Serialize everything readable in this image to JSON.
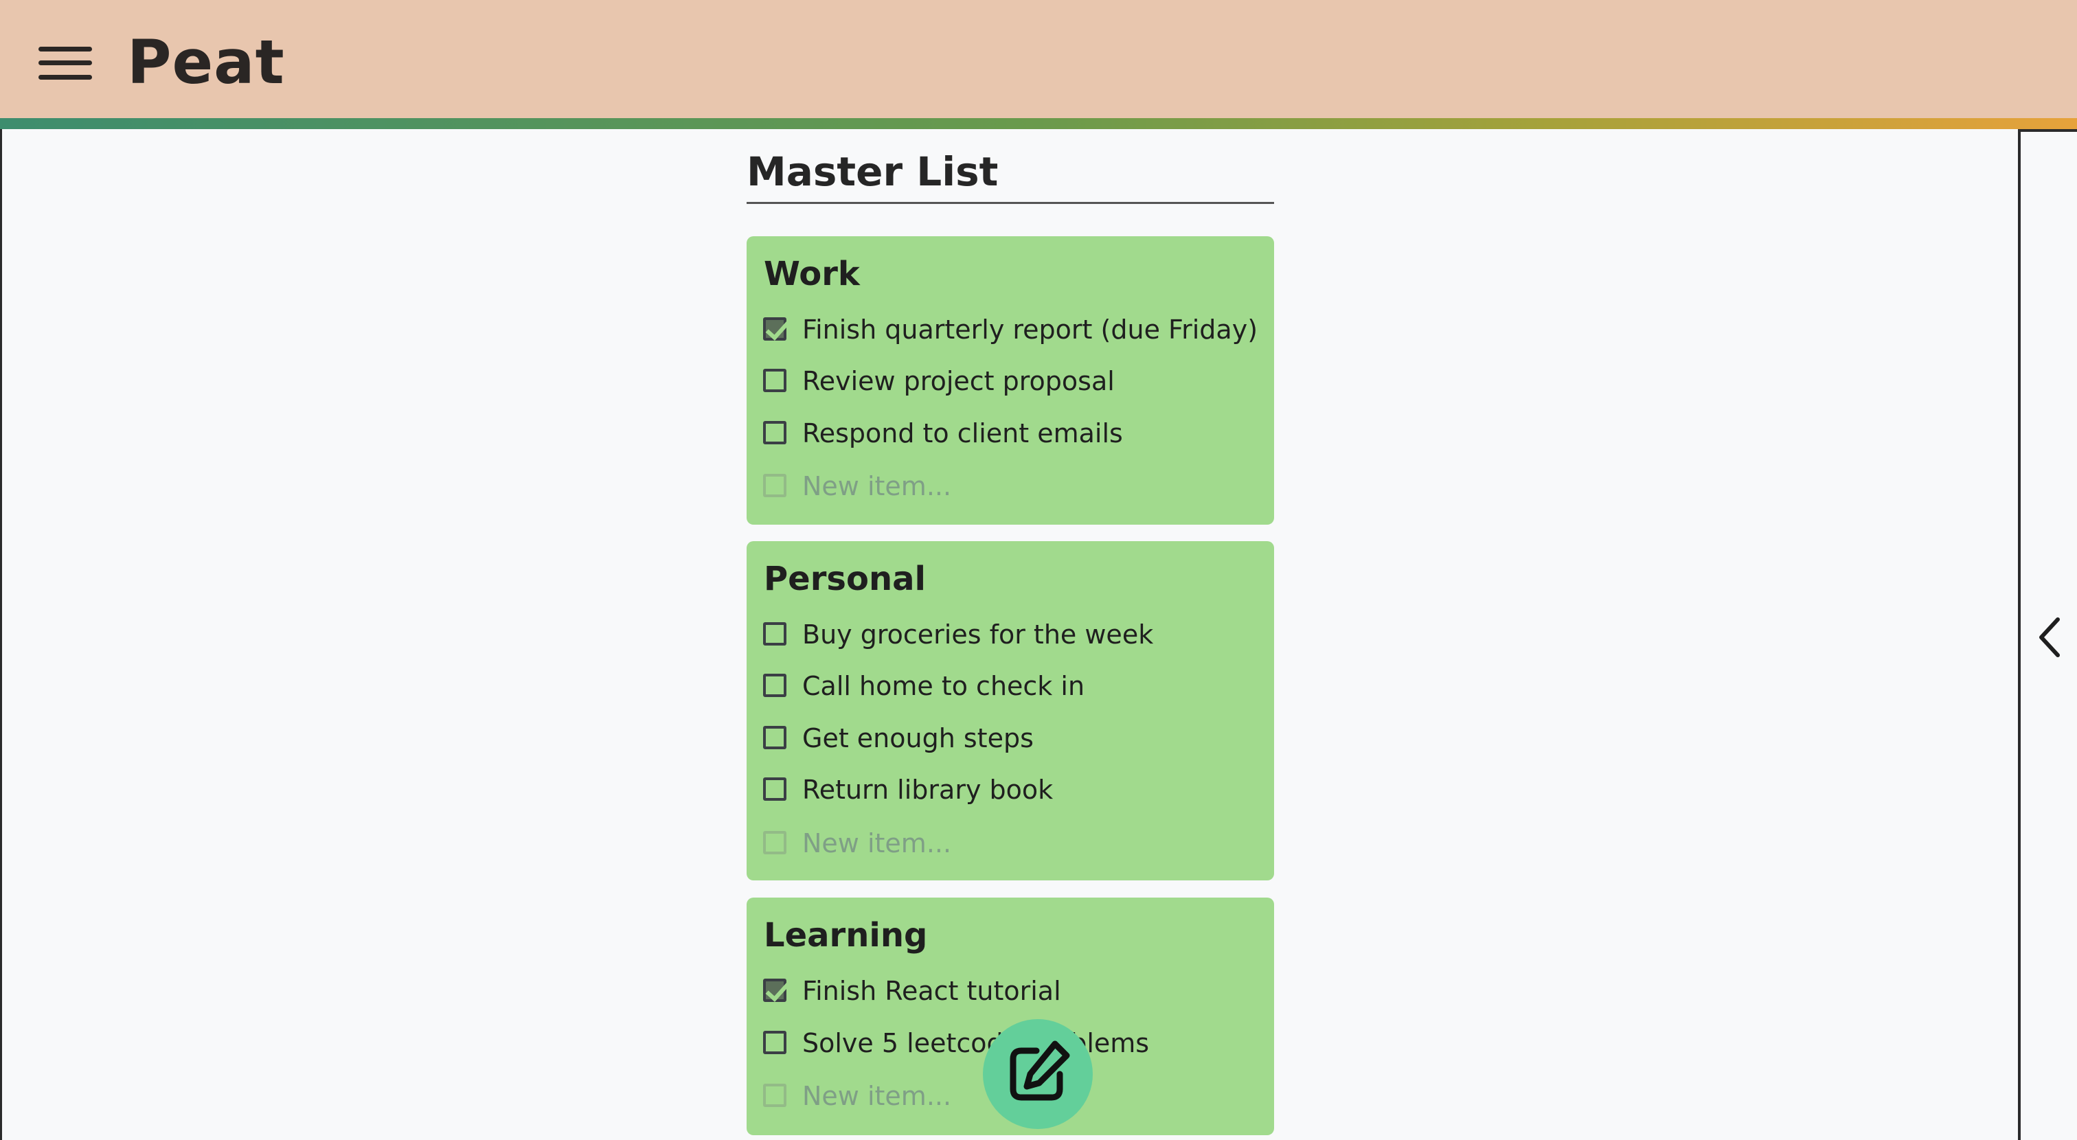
{
  "app": {
    "title": "Peat"
  },
  "page": {
    "heading": "Master List"
  },
  "lists": [
    {
      "title": "Work",
      "items": [
        {
          "label": "Finish quarterly report (due Friday)",
          "checked": true
        },
        {
          "label": "Review project proposal",
          "checked": false
        },
        {
          "label": "Respond to client emails",
          "checked": false
        }
      ],
      "new_item_placeholder": "New item..."
    },
    {
      "title": "Personal",
      "items": [
        {
          "label": "Buy groceries for the week",
          "checked": false
        },
        {
          "label": "Call home to check in",
          "checked": false
        },
        {
          "label": "Get enough steps",
          "checked": false
        },
        {
          "label": "Return library book",
          "checked": false
        }
      ],
      "new_item_placeholder": "New item..."
    },
    {
      "title": "Learning",
      "items": [
        {
          "label": "Finish React tutorial",
          "checked": true
        },
        {
          "label": "Solve 5 leetcode problems",
          "checked": false
        }
      ],
      "new_item_placeholder": "New item..."
    }
  ],
  "colors": {
    "header_bg": "#e8c6ae",
    "card_bg": "#a1da8d",
    "fab_bg": "#63cf9a",
    "page_bg": "#f8f9fa"
  },
  "icons": {
    "menu": "hamburger-menu-icon",
    "panel_toggle": "chevron-left-icon",
    "fab": "edit-icon"
  }
}
